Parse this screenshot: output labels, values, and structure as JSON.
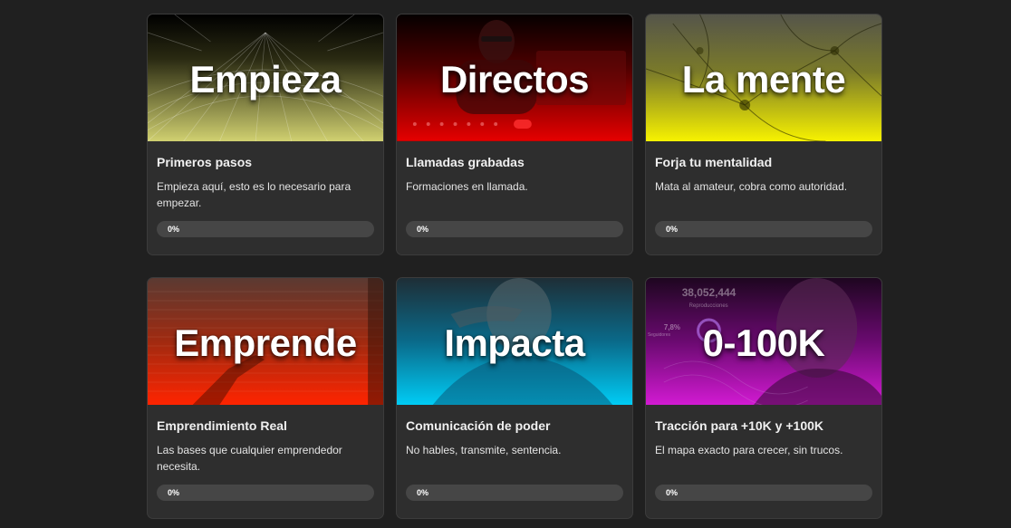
{
  "courses": [
    {
      "cover_title": "Empieza",
      "title": "Primeros pasos",
      "description": "Empieza aquí, esto es lo necesario para empezar.",
      "progress": 0,
      "progress_label": "0%",
      "cover_colors": [
        "#000000",
        "#cdcd6a"
      ]
    },
    {
      "cover_title": "Directos",
      "title": "Llamadas grabadas",
      "description": "Formaciones en llamada.",
      "progress": 0,
      "progress_label": "0%",
      "cover_colors": [
        "#000000",
        "#e00000"
      ]
    },
    {
      "cover_title": "La mente",
      "title": "Forja tu mentalidad",
      "description": "Mata al amateur, cobra como autoridad.",
      "progress": 0,
      "progress_label": "0%",
      "cover_colors": [
        "#4a4a3a",
        "#f5f000"
      ]
    },
    {
      "cover_title": "Emprende",
      "title": "Emprendimiento Real",
      "description": "Las bases que cualquier emprendedor necesita.",
      "progress": 0,
      "progress_label": "0%",
      "cover_colors": [
        "#5a3a30",
        "#ff2a00"
      ]
    },
    {
      "cover_title": "Impacta",
      "title": "Comunicación de poder",
      "description": "No hables, transmite, sentencia.",
      "progress": 0,
      "progress_label": "0%",
      "cover_colors": [
        "#1d3340",
        "#00c8f0"
      ]
    },
    {
      "cover_title": "0-100K",
      "title": "Tracción para +10K y +100K",
      "description": "El mapa exacto para crecer, sin trucos.",
      "progress": 0,
      "progress_label": "0%",
      "cover_colors": [
        "#2a0a33",
        "#d21ad2"
      ]
    }
  ],
  "cover_art": {
    "stat_number": "38,052,444",
    "stat_caption": "Reproducciones",
    "stat_percent": "7,8%",
    "stat_percent_caption": "Seguidores"
  },
  "colors": {
    "page_background": "#202020",
    "card_background": "#2e2e2e",
    "progress_track": "#464646"
  }
}
